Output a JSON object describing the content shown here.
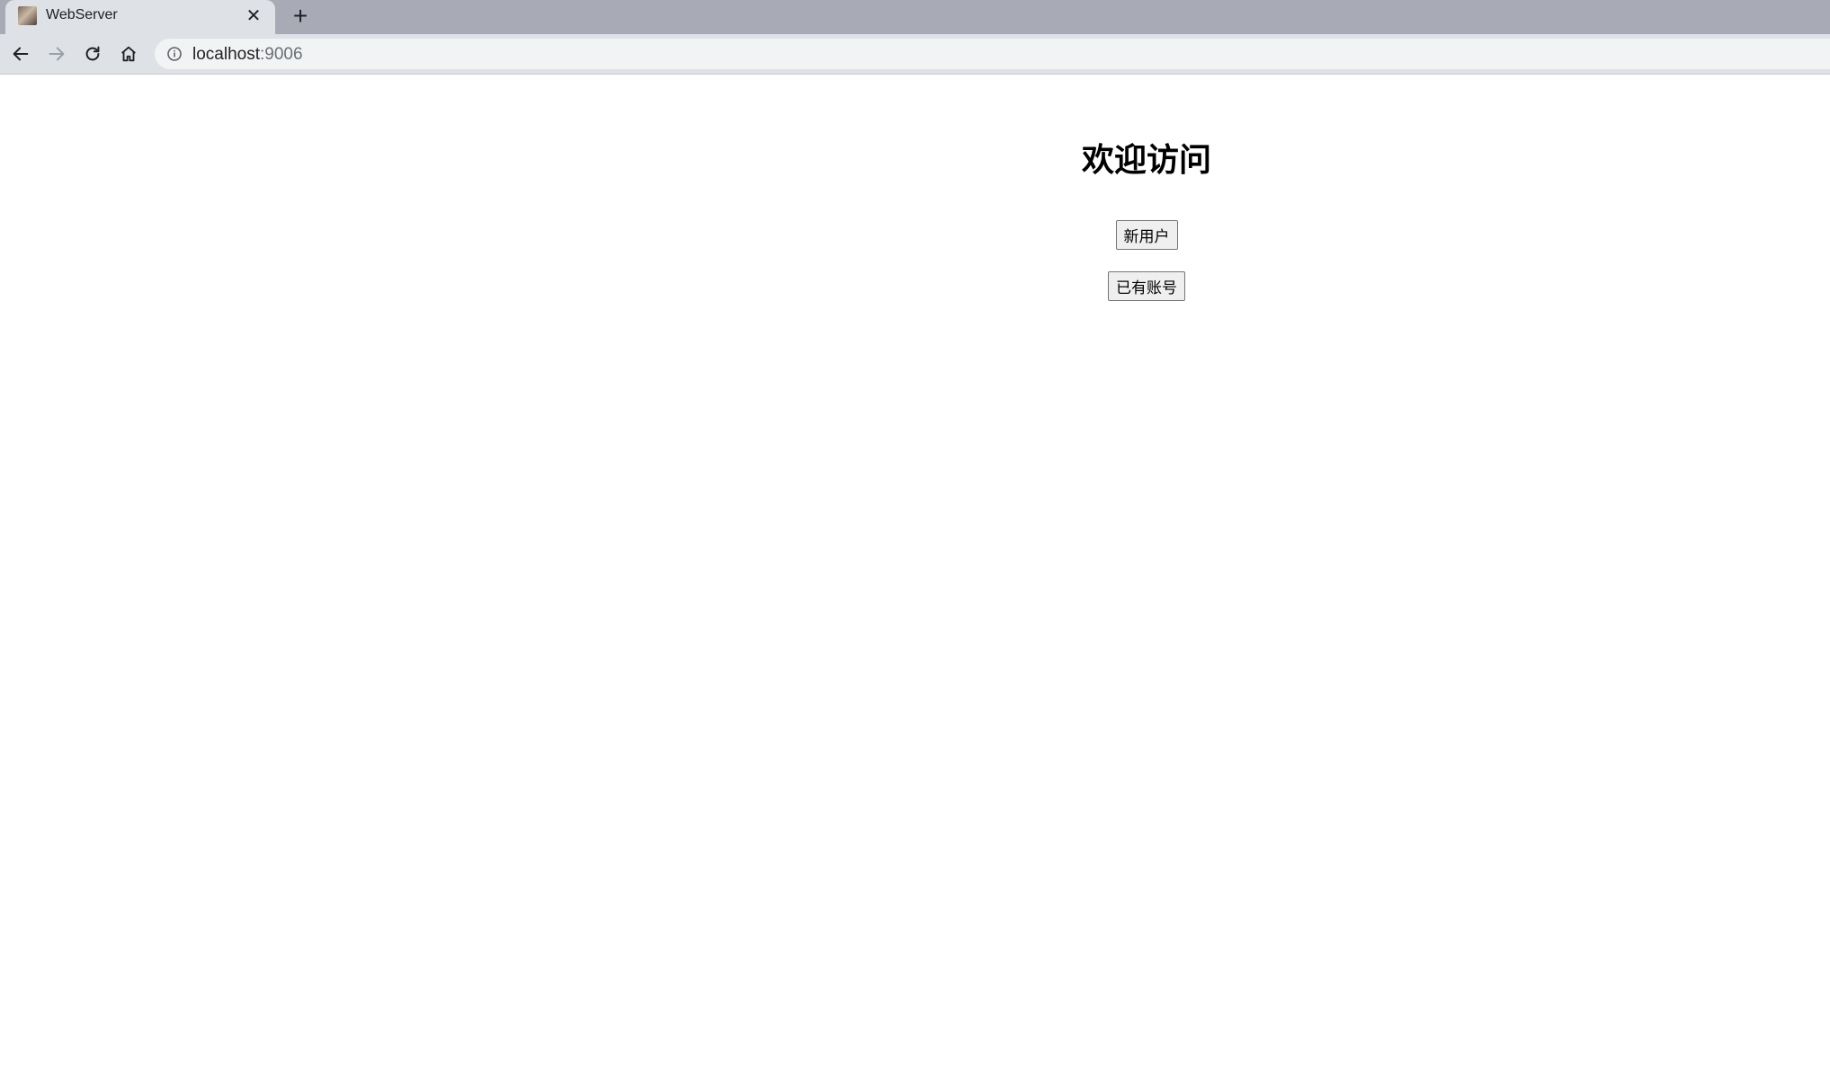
{
  "browser": {
    "tab": {
      "title": "WebServer",
      "close_glyph": "✕",
      "favicon": "site-favicon"
    },
    "new_tab_glyph": "+",
    "nav": {
      "back": "arrow-left-icon",
      "forward": "arrow-right-icon",
      "reload": "reload-icon",
      "home": "home-icon"
    },
    "address": {
      "host": "localhost",
      "port": ":9006",
      "security_icon": "info-icon"
    }
  },
  "page": {
    "heading": "欢迎访问",
    "buttons": {
      "new_user": "新用户",
      "existing_account": "已有账号"
    }
  }
}
